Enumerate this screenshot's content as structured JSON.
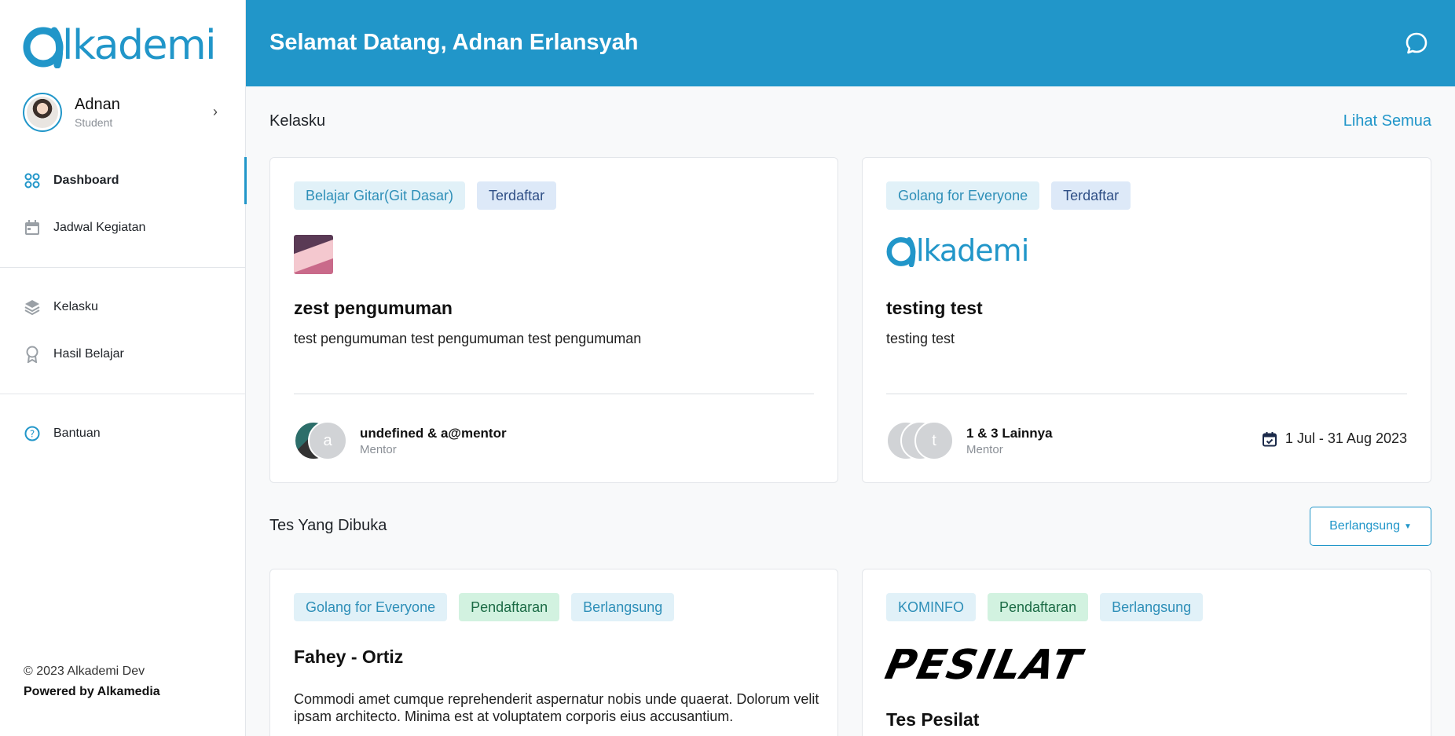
{
  "brand": {
    "logo_text": "lkademi",
    "accent": "#2196c9"
  },
  "profile": {
    "name": "Adnan",
    "role": "Student"
  },
  "nav": {
    "main": [
      {
        "label": "Dashboard",
        "icon": "grid-icon",
        "active": true
      },
      {
        "label": "Jadwal Kegiatan",
        "icon": "calendar-icon",
        "active": false
      }
    ],
    "learn": [
      {
        "label": "Kelasku",
        "icon": "layers-icon"
      },
      {
        "label": "Hasil Belajar",
        "icon": "award-icon"
      }
    ],
    "help": [
      {
        "label": "Bantuan",
        "icon": "help-circle-icon"
      }
    ]
  },
  "footer": {
    "copyright": "© 2023 Alkademi Dev",
    "powered": "Powered by Alkamedia"
  },
  "header": {
    "title": "Selamat Datang, Adnan Erlansyah"
  },
  "kelasku": {
    "title": "Kelasku",
    "see_all": "Lihat Semua",
    "cards": [
      {
        "course": "Belajar Gitar(Git Dasar)",
        "status": "Terdaftar",
        "title": "zest pengumuman",
        "desc": "test pengumuman test pengumuman test pengumuman",
        "mentor_name": "undefined & a@mentor",
        "mentor_role": "Mentor",
        "avatar_letter": "a"
      },
      {
        "course": "Golang for Everyone",
        "status": "Terdaftar",
        "logo_text": "lkademi",
        "title": "testing test",
        "desc": "testing test",
        "mentor_name": "1 & 3 Lainnya",
        "mentor_role": "Mentor",
        "avatar_letter": "t",
        "date": "1 Jul - 31 Aug 2023"
      }
    ]
  },
  "tests": {
    "title": "Tes Yang Dibuka",
    "filter": "Berlangsung",
    "cards": [
      {
        "course": "Golang for Everyone",
        "stage": "Pendaftaran",
        "status": "Berlangsung",
        "title": "Fahey - Ortiz",
        "desc": "Commodi amet cumque reprehenderit aspernatur nobis unde quaerat. Dolorum velit ipsam architecto. Minima est at voluptatem corporis eius accusantium."
      },
      {
        "course": "KOMINFO",
        "stage": "Pendaftaran",
        "status": "Berlangsung",
        "logo_text": "PESILAT",
        "title": "Tes Pesilat"
      }
    ]
  }
}
